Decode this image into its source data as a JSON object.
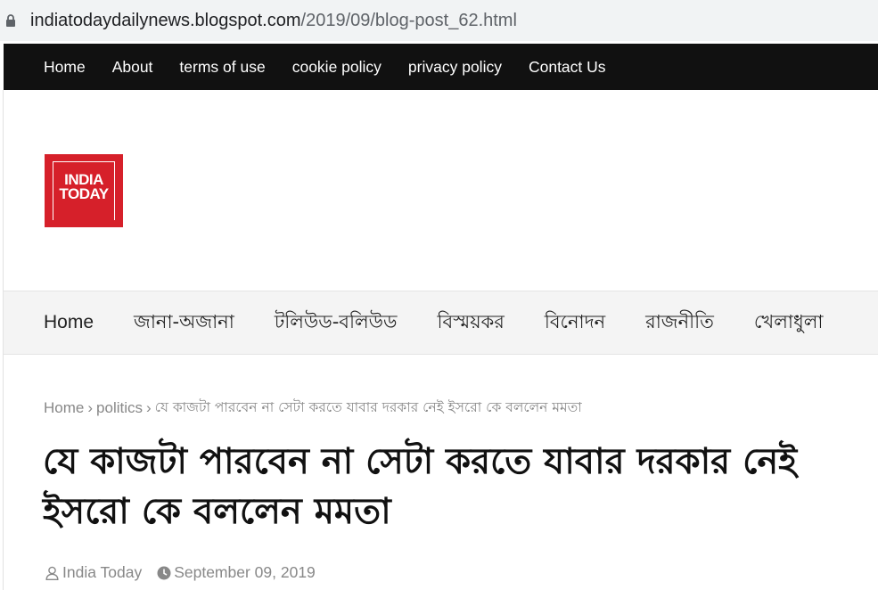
{
  "browser": {
    "url_host": "indiatodaydailynews.blogspot.com",
    "url_path": "/2019/09/blog-post_62.html"
  },
  "topnav": {
    "items": [
      "Home",
      "About",
      "terms of use",
      "cookie policy",
      "privacy policy",
      "Contact Us"
    ]
  },
  "logo": {
    "line1": "INDIA",
    "line2": "TODAY",
    "color": "#d6202a"
  },
  "catnav": {
    "items": [
      "Home",
      "জানা-অজানা",
      "টলিউড-বলিউড",
      "বিস্ময়কর",
      "বিনোদন",
      "রাজনীতি",
      "খেলাধুলা"
    ]
  },
  "breadcrumb": {
    "home": "Home",
    "section": "politics",
    "current": "যে কাজটা পারবেন না সেটা করতে যাবার দরকার নেই ইসরো কে বললেন মমতা"
  },
  "post": {
    "title": "যে কাজটা পারবেন না সেটা করতে যাবার দরকার নেই ইসরো কে বললেন মমতা",
    "author": "India Today",
    "date": "September 09, 2019",
    "author_icon": "user-icon",
    "date_icon": "clock-icon"
  }
}
